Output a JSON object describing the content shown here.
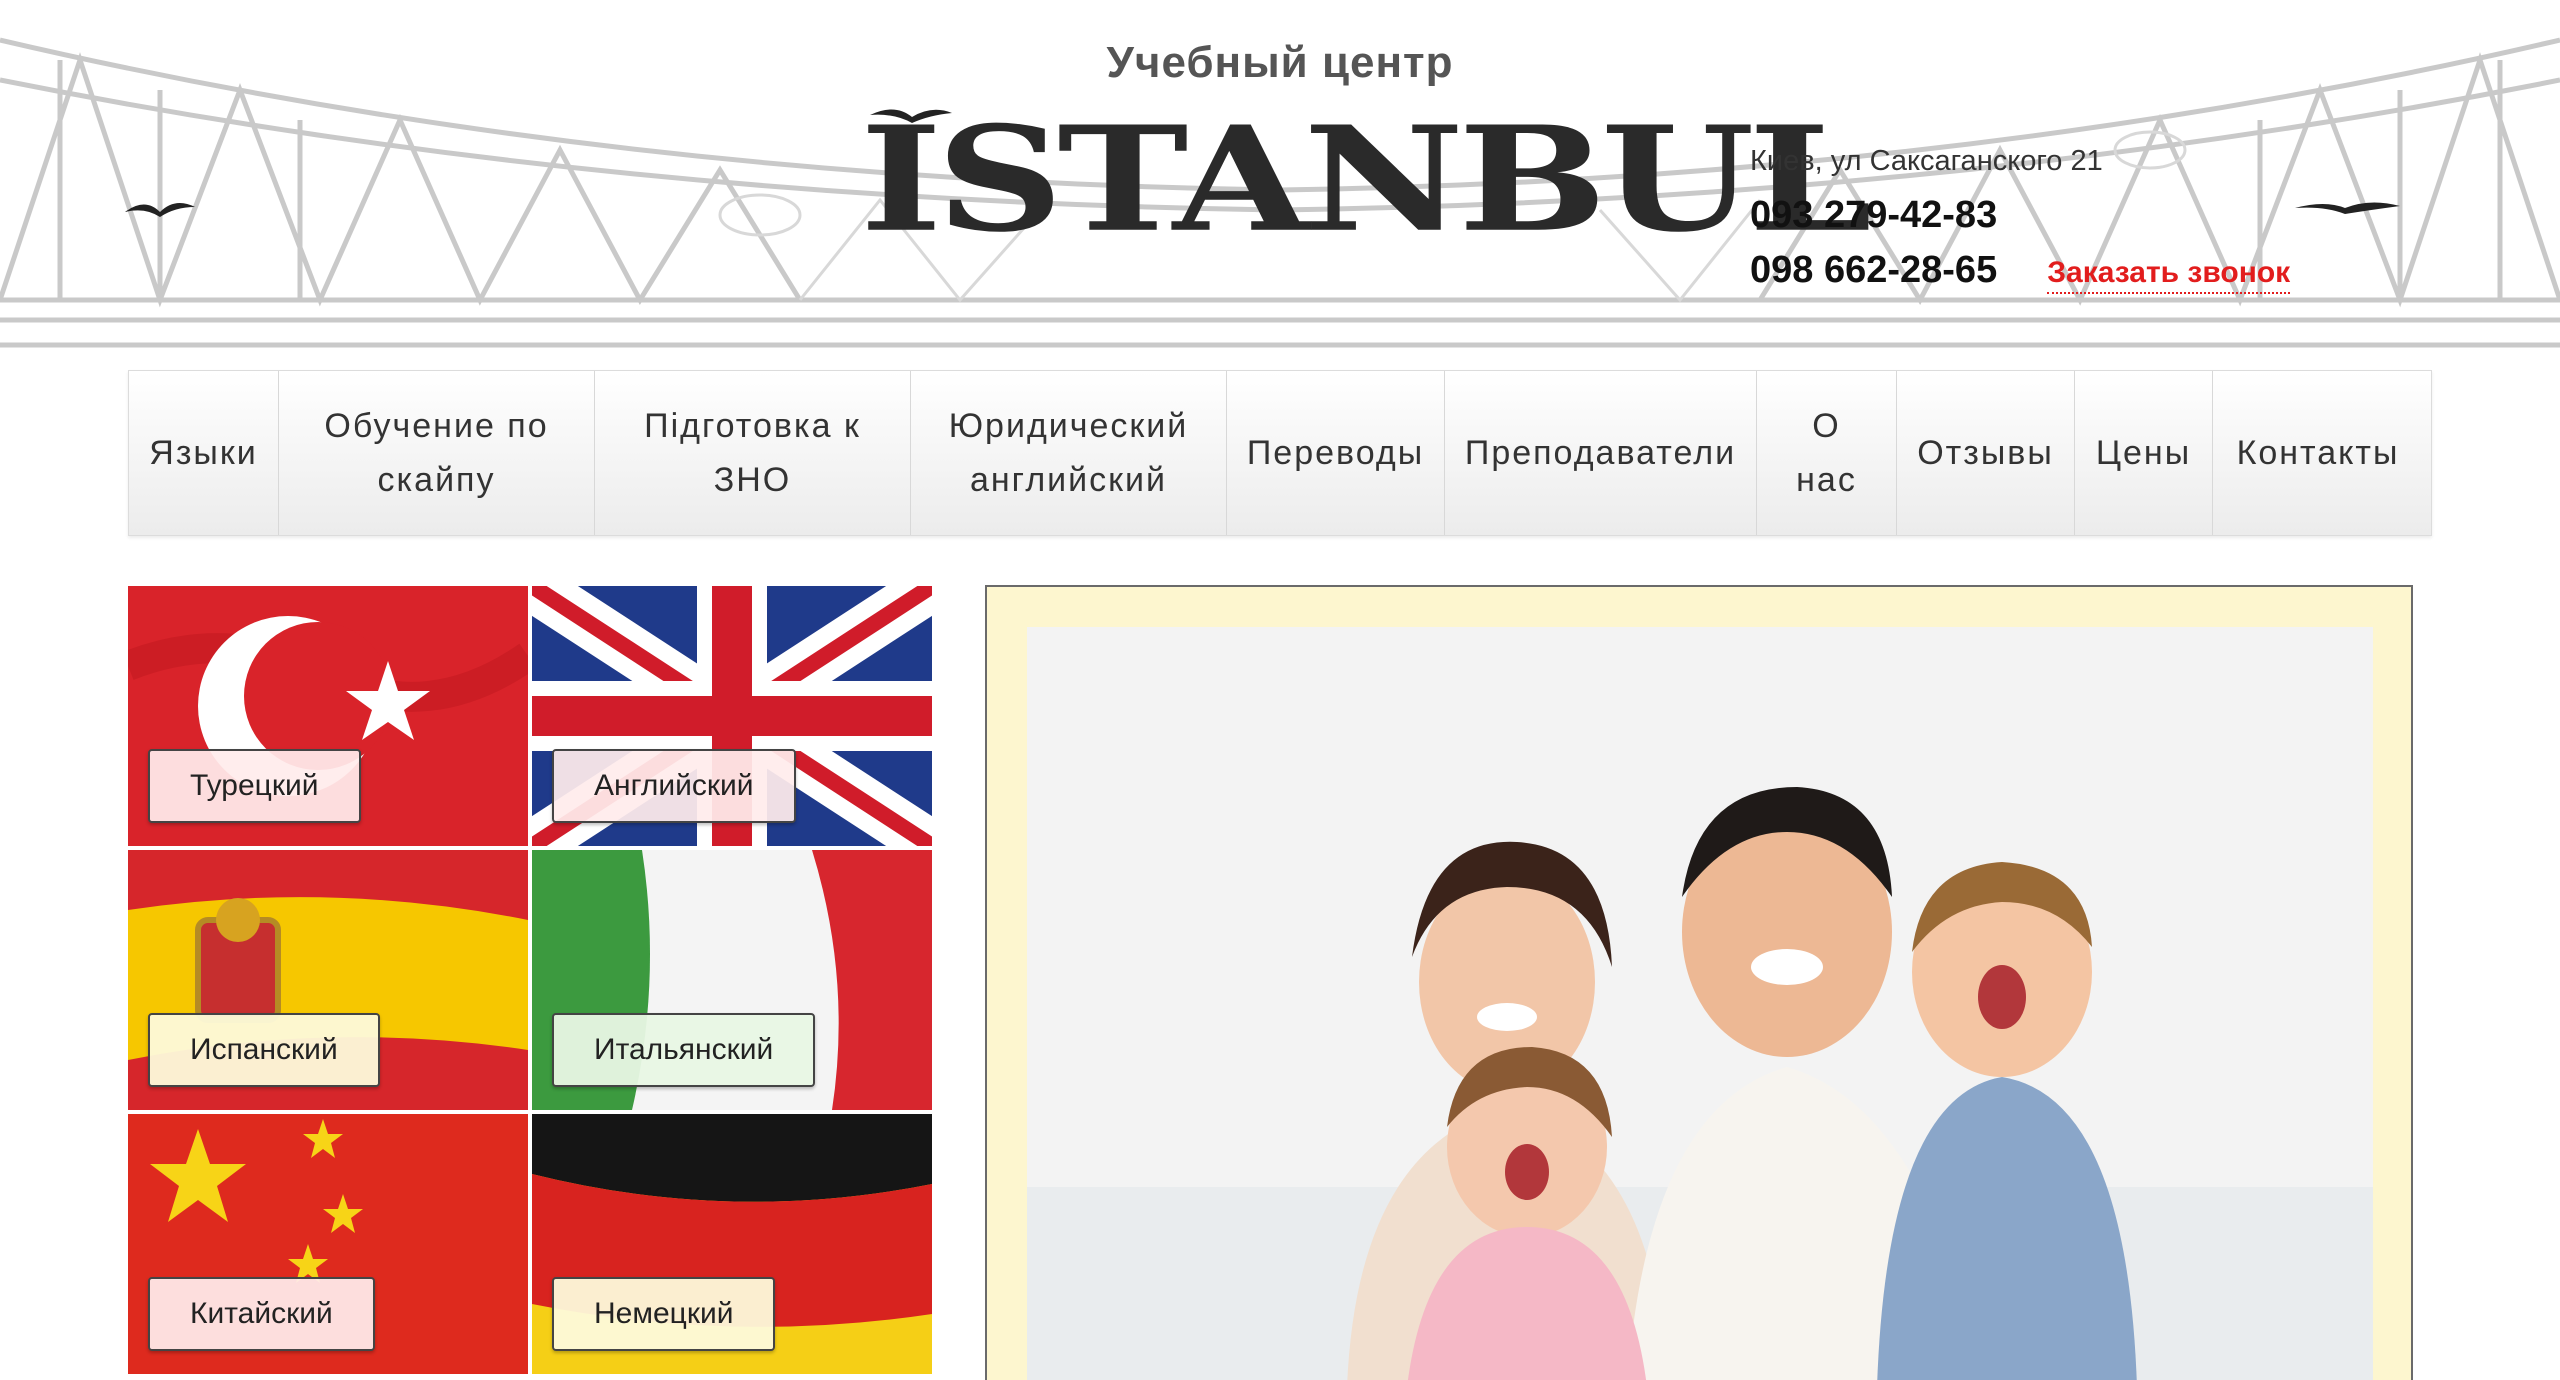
{
  "header": {
    "subtitle": "Учебный центр",
    "logo_text": "ISTANBUL"
  },
  "contacts": {
    "address": "Киев, ул Саксаганского 21",
    "phone_1": "093 279-42-83",
    "phone_2": "098 662-28-65",
    "callback_label": "Заказать звонок",
    "callback_color": "#e21d1d"
  },
  "nav": {
    "items": [
      {
        "label": "Языки"
      },
      {
        "label": "Обучение по скайпу"
      },
      {
        "label": "Підготовка к ЗНО"
      },
      {
        "label": "Юридический английский"
      },
      {
        "label": "Переводы"
      },
      {
        "label": "Преподаватели"
      },
      {
        "label": "О нас"
      },
      {
        "label": "Отзывы"
      },
      {
        "label": "Цены"
      },
      {
        "label": "Контакты"
      }
    ]
  },
  "languages": [
    {
      "label": "Турецкий",
      "flag_icon": "turkey-flag-icon"
    },
    {
      "label": "Английский",
      "flag_icon": "uk-flag-icon"
    },
    {
      "label": "Испанский",
      "flag_icon": "spain-flag-icon"
    },
    {
      "label": "Итальянский",
      "flag_icon": "italy-flag-icon"
    },
    {
      "label": "Китайский",
      "flag_icon": "china-flag-icon"
    },
    {
      "label": "Немецкий",
      "flag_icon": "germany-flag-icon"
    }
  ],
  "colors": {
    "frame_background": "#fdf6cf",
    "nav_text": "#333333"
  }
}
